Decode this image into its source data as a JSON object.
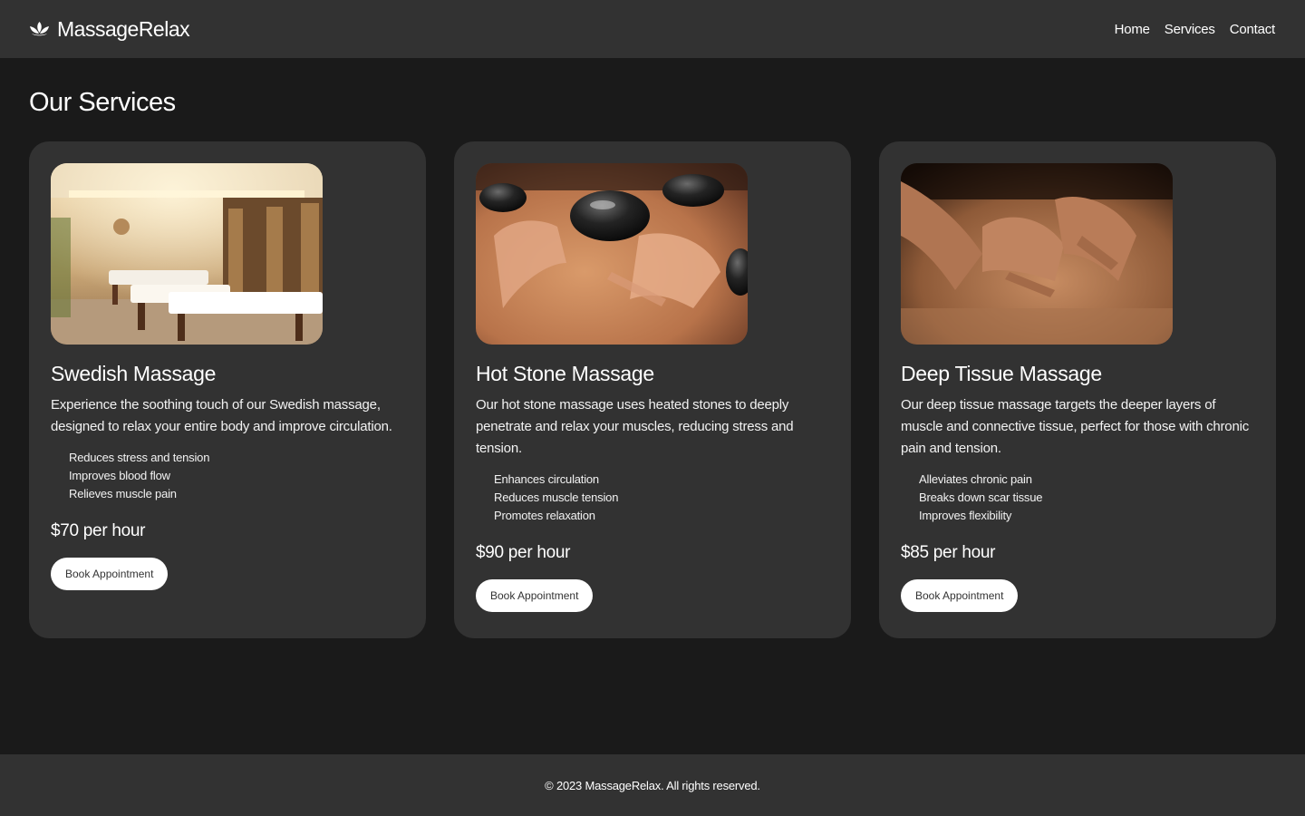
{
  "header": {
    "brand": "MassageRelax",
    "logo_icon": "lotus-icon",
    "nav": [
      {
        "label": "Home"
      },
      {
        "label": "Services"
      },
      {
        "label": "Contact"
      }
    ]
  },
  "main": {
    "title": "Our Services",
    "services": [
      {
        "name": "Swedish Massage",
        "image": "massage-room-photo",
        "description": "Experience the soothing touch of our Swedish massage, designed to relax your entire body and improve circulation.",
        "features": [
          "Reduces stress and tension",
          "Improves blood flow",
          "Relieves muscle pain"
        ],
        "price": "$70 per hour",
        "button": "Book Appointment"
      },
      {
        "name": "Hot Stone Massage",
        "image": "hot-stones-photo",
        "description": "Our hot stone massage uses heated stones to deeply penetrate and relax your muscles, reducing stress and tension.",
        "features": [
          "Enhances circulation",
          "Reduces muscle tension",
          "Promotes relaxation"
        ],
        "price": "$90 per hour",
        "button": "Book Appointment"
      },
      {
        "name": "Deep Tissue Massage",
        "image": "deep-tissue-hands-photo",
        "description": "Our deep tissue massage targets the deeper layers of muscle and connective tissue, perfect for those with chronic pain and tension.",
        "features": [
          "Alleviates chronic pain",
          "Breaks down scar tissue",
          "Improves flexibility"
        ],
        "price": "$85 per hour",
        "button": "Book Appointment"
      }
    ]
  },
  "footer": {
    "copyright": "© 2023 MassageRelax. All rights reserved."
  },
  "colors": {
    "background": "#1a1a1a",
    "surface": "#323232",
    "text": "#ffffff",
    "button_bg": "#ffffff",
    "button_text": "#333333"
  }
}
